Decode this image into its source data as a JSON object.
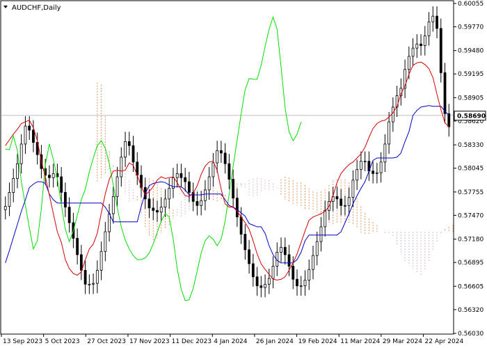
{
  "window": {
    "symbol_title": "AUDCHF,Daily",
    "menu_icon": "triangle-down-icon"
  },
  "colors": {
    "background": "#ffffff",
    "axis": "#000000",
    "candle": "#000000",
    "tenkan": "#d40000",
    "kijun": "#0000cc",
    "chikou": "#00dd00",
    "cloud_bull": "#e07830",
    "cloud_bear": "#c8a8c8",
    "price_line": "#c0c0c0"
  },
  "chart_data": {
    "type": "candlestick",
    "title": "AUDCHF,Daily",
    "indicator": "Ichimoku Kinko Hyo",
    "ylim": [
      0.5603,
      0.6008
    ],
    "y_ticks": [
      "0.60055",
      "0.59770",
      "0.59480",
      "0.59195",
      "0.58905",
      "0.58620",
      "0.58330",
      "0.58045",
      "0.57755",
      "0.57470",
      "0.57180",
      "0.56895",
      "0.56605",
      "0.56320",
      "0.56030"
    ],
    "x_labels": [
      "13 Sep 2023",
      "5 Oct 2023",
      "27 Oct 2023",
      "17 Nov 2023",
      "11 Dec 2023",
      "4 Jan 2024",
      "26 Jan 2024",
      "19 Feb 2024",
      "11 Mar 2024",
      "29 Mar 2024",
      "22 Apr 2024"
    ],
    "current_price": "0.58690",
    "current_price_value": 0.5869,
    "close": [
      0.5758,
      0.5775,
      0.5792,
      0.581,
      0.5834,
      0.5856,
      0.5851,
      0.5836,
      0.5821,
      0.5804,
      0.5796,
      0.5793,
      0.5798,
      0.5794,
      0.5775,
      0.5757,
      0.5738,
      0.5719,
      0.5699,
      0.568,
      0.5663,
      0.5663,
      0.5664,
      0.568,
      0.5703,
      0.5727,
      0.5749,
      0.577,
      0.5794,
      0.5818,
      0.5837,
      0.5832,
      0.5812,
      0.5796,
      0.5781,
      0.5767,
      0.5756,
      0.5753,
      0.5751,
      0.5757,
      0.5767,
      0.578,
      0.5793,
      0.5798,
      0.5793,
      0.5788,
      0.5775,
      0.5764,
      0.5759,
      0.5765,
      0.5778,
      0.5794,
      0.5811,
      0.5826,
      0.5823,
      0.581,
      0.5791,
      0.5768,
      0.5745,
      0.5724,
      0.5705,
      0.5688,
      0.5672,
      0.5661,
      0.5659,
      0.5663,
      0.567,
      0.5685,
      0.5702,
      0.5708,
      0.5699,
      0.5685,
      0.5669,
      0.5661,
      0.5661,
      0.5668,
      0.5681,
      0.5698,
      0.5715,
      0.5733,
      0.5753,
      0.5764,
      0.577,
      0.5767,
      0.5759,
      0.5759,
      0.5769,
      0.579,
      0.5803,
      0.5813,
      0.5813,
      0.5801,
      0.5798,
      0.5799,
      0.5812,
      0.5834,
      0.5861,
      0.5879,
      0.5893,
      0.5902,
      0.5925,
      0.5941,
      0.5951,
      0.5956,
      0.5954,
      0.5966,
      0.5983,
      0.599,
      0.5975,
      0.5921,
      0.5871,
      0.5855
    ],
    "tenkan": [
      0.5832,
      0.5839,
      0.5846,
      0.5852,
      0.5859,
      0.5861,
      0.5863,
      0.5854,
      0.5838,
      0.5813,
      0.5794,
      0.5772,
      0.5749,
      0.5727,
      0.5714,
      0.5693,
      0.5682,
      0.5676,
      0.5674,
      0.5678,
      0.5693,
      0.5706,
      0.5712,
      0.5725,
      0.575,
      0.5773,
      0.5791,
      0.5801,
      0.5802,
      0.5801,
      0.5802,
      0.5811,
      0.5808,
      0.5796,
      0.5782,
      0.5772,
      0.5776,
      0.5782,
      0.579,
      0.5794,
      0.5792,
      0.5793,
      0.5794,
      0.5787,
      0.5778,
      0.5771,
      0.577,
      0.5774,
      0.5783,
      0.5797,
      0.5807,
      0.5812,
      0.5813,
      0.5802,
      0.5779,
      0.5761,
      0.5757,
      0.5757,
      0.5752,
      0.5745,
      0.5738,
      0.573,
      0.5716,
      0.57,
      0.5688,
      0.5681,
      0.5675,
      0.5669,
      0.5668,
      0.5669,
      0.5672,
      0.568,
      0.5689,
      0.57,
      0.5714,
      0.5728,
      0.5741,
      0.5745,
      0.5747,
      0.5749,
      0.5752,
      0.5758,
      0.5771,
      0.5787,
      0.5798,
      0.5804,
      0.5809,
      0.5812,
      0.5817,
      0.5822,
      0.583,
      0.5842,
      0.5853,
      0.5859,
      0.5862,
      0.5863,
      0.5867,
      0.5872,
      0.588,
      0.5895,
      0.5905,
      0.5919,
      0.593,
      0.5933,
      0.5934,
      0.5931,
      0.5926,
      0.5915,
      0.5895,
      0.5876,
      0.586,
      0.5855
    ],
    "kijun": [
      0.5689,
      0.5704,
      0.572,
      0.5736,
      0.5752,
      0.5766,
      0.5781,
      0.5785,
      0.5788,
      0.5788,
      0.5786,
      0.5773,
      0.5766,
      0.5762,
      0.5762,
      0.5762,
      0.5762,
      0.5762,
      0.5762,
      0.5762,
      0.5762,
      0.5762,
      0.5762,
      0.5762,
      0.5762,
      0.5757,
      0.5749,
      0.5739,
      0.5739,
      0.5739,
      0.5739,
      0.5739,
      0.5739,
      0.5739,
      0.5758,
      0.5774,
      0.5783,
      0.5786,
      0.5787,
      0.5788,
      0.5787,
      0.5784,
      0.5782,
      0.5782,
      0.5782,
      0.5778,
      0.5772,
      0.5772,
      0.5772,
      0.5772,
      0.5773,
      0.5773,
      0.5773,
      0.5773,
      0.5773,
      0.5766,
      0.5759,
      0.5757,
      0.5754,
      0.575,
      0.5746,
      0.5737,
      0.5735,
      0.5733,
      0.5733,
      0.5725,
      0.571,
      0.5699,
      0.5692,
      0.5689,
      0.5689,
      0.5689,
      0.5689,
      0.5693,
      0.5702,
      0.5716,
      0.5723,
      0.5723,
      0.5723,
      0.5723,
      0.5723,
      0.5723,
      0.5723,
      0.5723,
      0.5727,
      0.5738,
      0.5749,
      0.5761,
      0.5771,
      0.578,
      0.5788,
      0.5801,
      0.5814,
      0.5817,
      0.5817,
      0.5817,
      0.5817,
      0.5817,
      0.5818,
      0.5823,
      0.5837,
      0.5849,
      0.5869,
      0.5875,
      0.5879,
      0.588,
      0.5881,
      0.588,
      0.588,
      0.588,
      0.5874,
      0.5869
    ],
    "chikou": [
      0.5828,
      0.5827,
      0.5844,
      0.5826,
      0.5788,
      0.5759,
      0.5732,
      0.5706,
      0.5716,
      0.5755,
      0.5809,
      0.5834,
      0.5815,
      0.5792,
      0.576,
      0.573,
      0.5715,
      0.5728,
      0.5747,
      0.5766,
      0.5779,
      0.58,
      0.5817,
      0.5832,
      0.5838,
      0.5829,
      0.581,
      0.5784,
      0.5756,
      0.5733,
      0.5717,
      0.5706,
      0.5698,
      0.5693,
      0.5693,
      0.5695,
      0.5701,
      0.5712,
      0.5726,
      0.574,
      0.5749,
      0.5745,
      0.5718,
      0.5682,
      0.5657,
      0.5643,
      0.5644,
      0.5658,
      0.5679,
      0.5701,
      0.5716,
      0.5722,
      0.5718,
      0.571,
      0.5718,
      0.574,
      0.5773,
      0.5807,
      0.5839,
      0.5871,
      0.59,
      0.5914,
      0.5913,
      0.5913,
      0.593,
      0.5953,
      0.5974,
      0.5989,
      0.5974,
      0.5928,
      0.5878,
      0.5849,
      0.5838,
      0.5846,
      0.5861
    ],
    "cloud_span_a": [
      0.5909,
      0.5906,
      0.5868,
      0.5825,
      0.5808,
      0.5798,
      0.5786,
      0.5773,
      0.5764,
      0.5765,
      0.577,
      0.5779,
      0.5789,
      0.5792,
      0.579,
      0.5785,
      0.578,
      0.5774,
      0.5764,
      0.5754,
      0.5747,
      0.5744,
      0.5746,
      0.5752,
      0.5758,
      0.5766,
      0.5772,
      0.5783,
      0.5786,
      0.5781,
      0.5776,
      0.5772,
      0.5772,
      0.5771,
      0.5777,
      0.5786,
      0.5786,
      0.5781,
      0.577,
      0.5769,
      0.5771,
      0.5775,
      0.5777,
      0.5778,
      0.5778,
      0.578,
      0.5791,
      0.5794,
      0.5793,
      0.579,
      0.5787,
      0.5787,
      0.5784,
      0.578,
      0.5776,
      0.5775,
      0.5776,
      0.5779,
      0.5784,
      0.5789,
      0.5791,
      0.5791,
      0.5791,
      0.5787,
      0.5779,
      0.5768,
      0.5758,
      0.575,
      0.5743,
      0.5739,
      0.5735,
      0.5727,
      0.5724,
      0.5725,
      0.5722,
      0.5712,
      0.5699,
      0.569,
      0.5686,
      0.5682,
      0.5676,
      0.5673,
      0.5681,
      0.5691,
      0.5703,
      0.5714,
      0.5723,
      0.573,
      0.5733,
      0.5735,
      0.5739,
      0.5743,
      0.5746,
      0.5749,
      0.5753,
      0.5763,
      0.5775,
      0.5784,
      0.5788,
      0.5791,
      0.5795
    ],
    "cloud_span_b": [
      0.5788,
      0.5791,
      0.5798,
      0.5803,
      0.5806,
      0.5807,
      0.5803,
      0.5798,
      0.5789,
      0.5779,
      0.5764,
      0.5748,
      0.5733,
      0.5722,
      0.5717,
      0.5719,
      0.5725,
      0.5731,
      0.5735,
      0.5743,
      0.5755,
      0.5764,
      0.577,
      0.5776,
      0.5778,
      0.5779,
      0.5776,
      0.577,
      0.5767,
      0.5764,
      0.5763,
      0.5765,
      0.5769,
      0.5773,
      0.5776,
      0.578,
      0.5782,
      0.5786,
      0.579,
      0.5792,
      0.5793,
      0.5792,
      0.5791,
      0.579,
      0.5786,
      0.5781,
      0.5772,
      0.5766,
      0.5763,
      0.5761,
      0.5759,
      0.5757,
      0.5755,
      0.5754,
      0.5753,
      0.575,
      0.5746,
      0.5741,
      0.5736,
      0.5735,
      0.5737,
      0.5738,
      0.5738,
      0.5738,
      0.5736,
      0.5731,
      0.5726,
      0.5723,
      0.5724,
      0.5726,
      0.5727,
      0.5727,
      0.5727,
      0.5727,
      0.5727,
      0.5727,
      0.5727,
      0.5727,
      0.5727,
      0.5727,
      0.5727,
      0.5727,
      0.5727,
      0.5727,
      0.5727,
      0.5727,
      0.5727,
      0.5727,
      0.5727,
      0.5727,
      0.5727,
      0.5727,
      0.5727,
      0.5727,
      0.5727,
      0.5727,
      0.5727,
      0.5727,
      0.5727,
      0.5727,
      0.5727
    ]
  }
}
